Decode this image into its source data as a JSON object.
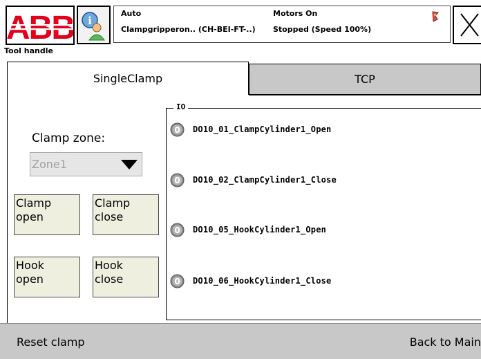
{
  "header": {
    "logo_text": "ABB",
    "status": {
      "mode": "Auto",
      "task": "Clampgripperon.. (CH-BEI-FT-..)",
      "motors": "Motors On",
      "state": "Stopped (Speed 100%)"
    },
    "icons": {
      "info": "info-person-icon",
      "flag": "flag-icon",
      "close": "close-icon"
    }
  },
  "window_title": "Tool handle",
  "tabs": [
    {
      "label": "SingleClamp",
      "active": true
    },
    {
      "label": "TCP",
      "active": false
    }
  ],
  "clamp": {
    "zone_label": "Clamp zone:",
    "zone_value": "Zone1",
    "buttons": {
      "clamp_open": [
        "Clamp",
        "open"
      ],
      "clamp_close": [
        "Clamp",
        "close"
      ],
      "hook_open": [
        "Hook",
        "open"
      ],
      "hook_close": [
        "Hook",
        "close"
      ]
    }
  },
  "io": {
    "legend": "IO",
    "signals": [
      {
        "name": "DO10_01_ClampCylinder1_Open",
        "value": "0"
      },
      {
        "name": "DO10_02_ClampCylinder1_Close",
        "value": "0"
      },
      {
        "name": "DO10_05_HookCylinder1_Open",
        "value": "0"
      },
      {
        "name": "DO10_06_HookCylinder1_Close",
        "value": "0"
      }
    ]
  },
  "bottom": {
    "reset_label": "Reset clamp",
    "back_label": "Back to Main"
  },
  "colors": {
    "abb_red": "#e2001a",
    "button_bg": "#efefe0",
    "bar_gray": "#c8c8c8",
    "led_gray": "#8a8a8a"
  }
}
